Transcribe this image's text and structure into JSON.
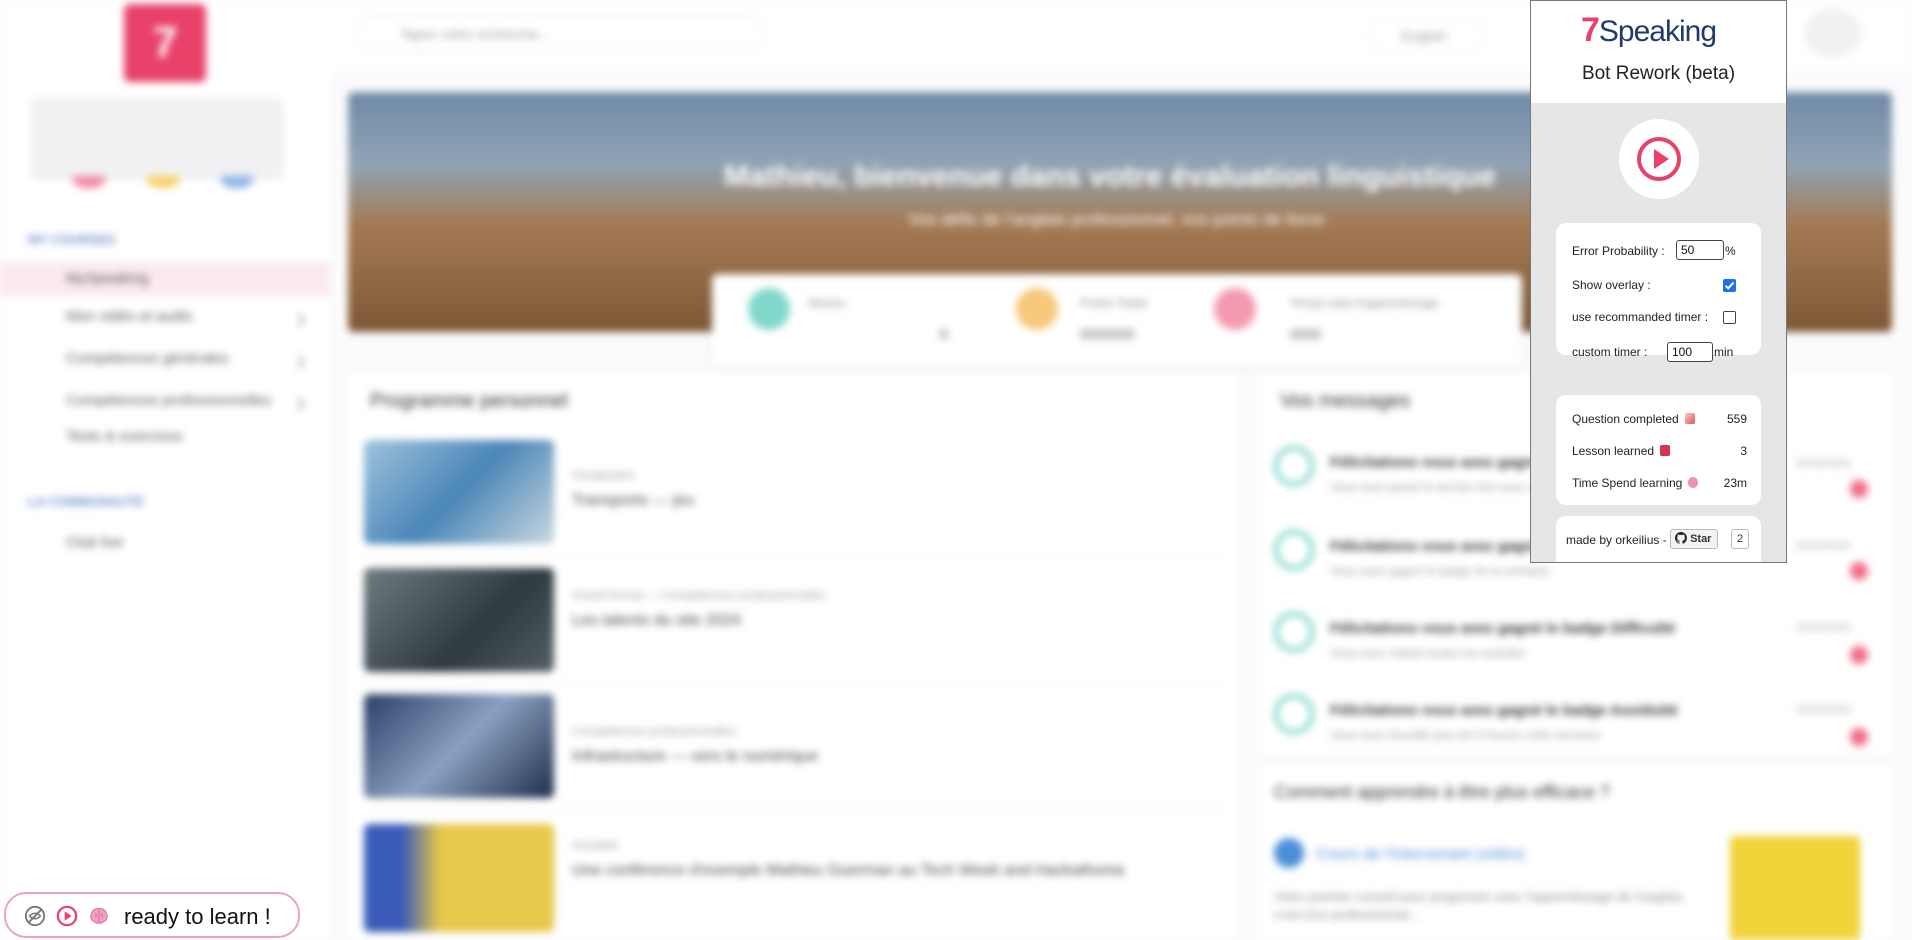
{
  "background": {
    "logo_char": "7",
    "search_placeholder": "Tapez votre recherche...",
    "language": "English",
    "sidebar": {
      "section_courses": "MY COURSES",
      "items": [
        {
          "label": "MySpeaking"
        },
        {
          "label": "Mon vidéo et audio"
        },
        {
          "label": "Compétences générales"
        },
        {
          "label": "Compétences professionnelles"
        },
        {
          "label": "Tests & exercices"
        }
      ],
      "section_community": "LA COMMUNAUTÉ",
      "community_items": [
        {
          "label": "Club live"
        }
      ]
    },
    "banner": {
      "title": "Mathieu, bienvenue dans votre évaluation linguistique",
      "subtitle": "Vos défis de l'anglais professionnel, vos points de force"
    },
    "stats": [
      {
        "label": "Niveau",
        "value": "8"
      },
      {
        "label": "Points Totals",
        "value": "0000000"
      },
      {
        "label": "Temps total d'apprentissage",
        "value": "0000"
      }
    ],
    "program_title": "Programme personnel",
    "program_items": [
      {
        "meta": "Vocabulaire",
        "title": "Transports — jeu"
      },
      {
        "meta": "Grand format — Compétences professionnelles",
        "title": "Les talents du site 2024"
      },
      {
        "meta": "Compétences professionnelles",
        "title": "Infrastructure — vers le numérique"
      },
      {
        "meta": "Actualité",
        "title": "Une conférence d'exemple Mathieu Guerman au Tech Week and Hackathonia"
      }
    ],
    "messages_title": "Vos messages",
    "messages": [
      {
        "title": "Félicitations vous avez gagné un badge",
        "body": "Vous avez passé le dernier test avec succès",
        "date": "00/00/0000"
      },
      {
        "title": "Félicitations vous avez gagné un badge",
        "body": "Vous avez gagné le badge de la semaine",
        "date": "00/00/0000"
      },
      {
        "title": "Félicitations vous avez gagné le badge Difficulté",
        "body": "Vous avez réalisé toutes les activités",
        "date": "00/00/0000"
      },
      {
        "title": "Félicitations vous avez gagné le badge Assiduité",
        "body": "Vous avez travaillé plus de 5 heures cette semaine",
        "date": "00/00/0000"
      }
    ],
    "learn_title": "Comment apprendre à être plus efficace ?",
    "learn_link": "Cours de l'intervenant (vidéo)",
    "learn_text": "Votre premier conseil pour progresser avec l'apprentissage de l'anglais, c'est d'un professionnel..."
  },
  "popup": {
    "logo_seven": "7",
    "logo_text": "Speaking",
    "subtitle": "Bot Rework (beta)",
    "play_button": "play-circle-icon",
    "options": {
      "error_probability": {
        "label": "Error Probability :",
        "value": "50",
        "unit": "%"
      },
      "show_overlay": {
        "label": "Show overlay :",
        "checked": true
      },
      "use_recommended_timer": {
        "label": "use recommanded timer :",
        "checked": false
      },
      "custom_timer": {
        "label": "custom timer :",
        "value": "100",
        "unit": "min"
      }
    },
    "stats": [
      {
        "label": "Question completed",
        "icon": "hundred-points-icon",
        "value": "559"
      },
      {
        "label": "Lesson learned",
        "icon": "book-icon",
        "value": "3"
      },
      {
        "label": "Time Spend learning",
        "icon": "brain-icon",
        "value": "23m"
      }
    ],
    "footer": {
      "made_by": "made by orkeilius -",
      "star_label": "Star",
      "star_count": "2"
    }
  },
  "overlay": {
    "status_text": "ready to learn !",
    "icons": [
      "eye-off-icon",
      "play-circle-icon",
      "brain-icon"
    ]
  },
  "colors": {
    "accent": "#e8416a",
    "checkbox_on": "#1a73e8",
    "overlay_border": "#f4a3b6"
  }
}
